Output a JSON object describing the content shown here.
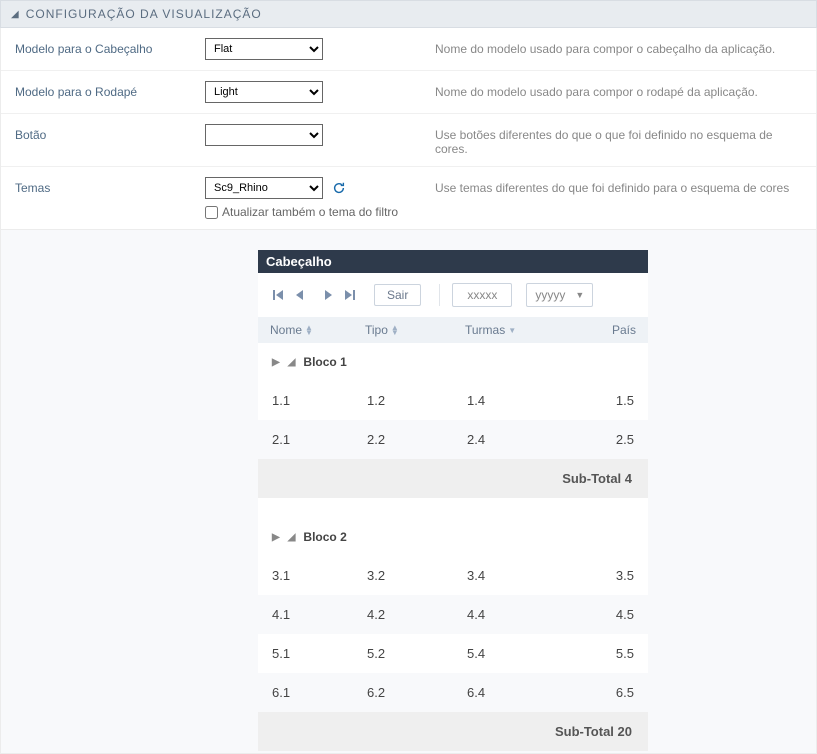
{
  "section": {
    "title": "CONFIGURAÇÃO DA VISUALIZAÇÃO"
  },
  "rows": {
    "header_model": {
      "label": "Modelo para o Cabeçalho",
      "value": "Flat",
      "desc": "Nome do modelo usado para compor o cabeçalho da aplicação."
    },
    "footer_model": {
      "label": "Modelo para o Rodapé",
      "value": "Light",
      "desc": "Nome do modelo usado para compor o rodapé da aplicação."
    },
    "button": {
      "label": "Botão",
      "value": "",
      "desc": "Use botões diferentes do que o que foi definido no esquema de cores."
    },
    "themes": {
      "label": "Temas",
      "value": "Sc9_Rhino",
      "desc": "Use temas diferentes do que foi definido para o esquema de cores",
      "checkbox_label": "Atualizar também o tema do filtro"
    }
  },
  "preview": {
    "cabecalho": "Cabeçalho",
    "sair": "Sair",
    "xxxxx": "xxxxx",
    "yyyyy": "yyyyy",
    "headers": {
      "nome": "Nome",
      "tipo": "Tipo",
      "turmas": "Turmas",
      "pais": "País"
    },
    "blocks": [
      {
        "title": "Bloco 1",
        "rows": [
          {
            "c1": "1.1",
            "c2": "1.2",
            "c3": "1.4",
            "c4": "1.5"
          },
          {
            "c1": "2.1",
            "c2": "2.2",
            "c3": "2.4",
            "c4": "2.5"
          }
        ],
        "subtotal": "Sub-Total 4"
      },
      {
        "title": "Bloco 2",
        "rows": [
          {
            "c1": "3.1",
            "c2": "3.2",
            "c3": "3.4",
            "c4": "3.5"
          },
          {
            "c1": "4.1",
            "c2": "4.2",
            "c3": "4.4",
            "c4": "4.5"
          },
          {
            "c1": "5.1",
            "c2": "5.2",
            "c3": "5.4",
            "c4": "5.5"
          },
          {
            "c1": "6.1",
            "c2": "6.2",
            "c3": "6.4",
            "c4": "6.5"
          }
        ],
        "subtotal": "Sub-Total 20"
      }
    ]
  }
}
